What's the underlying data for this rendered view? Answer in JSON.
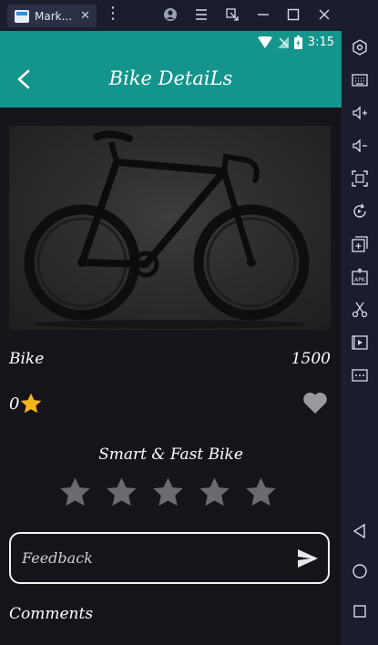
{
  "emulator": {
    "tab_title": "Mark...",
    "tab_close": "✕",
    "more": "⋮"
  },
  "status_bar": {
    "time": "3:15"
  },
  "header": {
    "title": "Bike DetaiLs"
  },
  "product": {
    "name": "Bike",
    "price": "1500",
    "rating_count": "0",
    "subtitle": "Smart & Fast Bike",
    "stars": 5
  },
  "feedback": {
    "placeholder": "Feedback"
  },
  "comments_heading": "Comments",
  "colors": {
    "header": "#14958c",
    "star_filled": "#f5b417",
    "star_empty": "#6b6b6f",
    "background": "#16141b"
  }
}
